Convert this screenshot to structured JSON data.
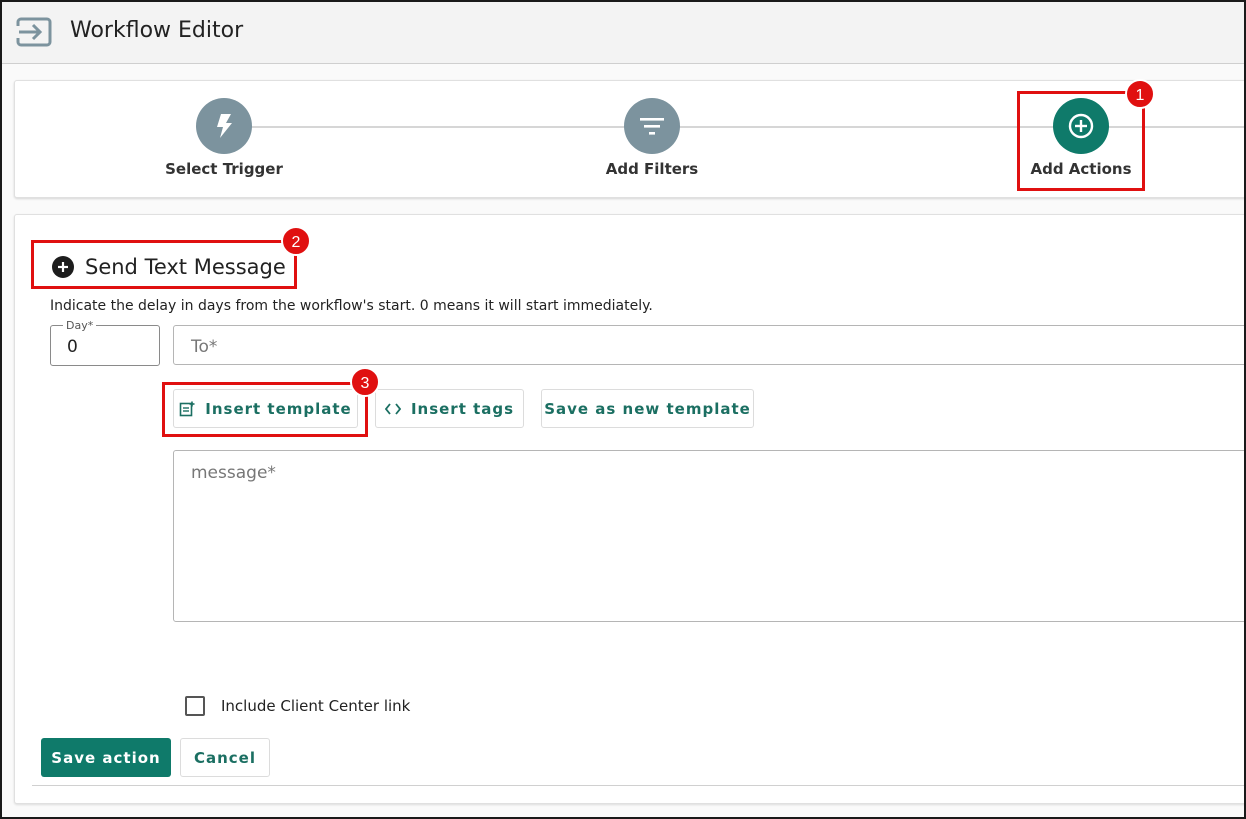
{
  "header": {
    "title": "Workflow Editor",
    "icon": "exit-arrow-icon"
  },
  "stepper": {
    "steps": [
      {
        "label": "Select Trigger",
        "icon": "lightning-icon",
        "state": "inactive"
      },
      {
        "label": "Add Filters",
        "icon": "filter-icon",
        "state": "inactive"
      },
      {
        "label": "Add Actions",
        "icon": "plus-circle-icon",
        "state": "active"
      }
    ]
  },
  "annotations": {
    "badges": [
      "1",
      "2",
      "3"
    ],
    "highlight_color": "#e01010"
  },
  "action": {
    "title": "Send Text Message",
    "delay_hint": "Indicate the delay in days from the workflow's start. 0 means it will start immediately.",
    "day_label": "Day*",
    "day_value": "0",
    "to_placeholder": "To*",
    "insert_template_label": "Insert template",
    "insert_tags_label": "Insert tags",
    "save_template_label": "Save as new template",
    "message_placeholder": "message*",
    "client_center_label": "Include Client Center link",
    "client_center_checked": false,
    "save_label": "Save action",
    "cancel_label": "Cancel"
  },
  "colors": {
    "accent": "#0f7a6a",
    "step_inactive": "#7c939e"
  }
}
